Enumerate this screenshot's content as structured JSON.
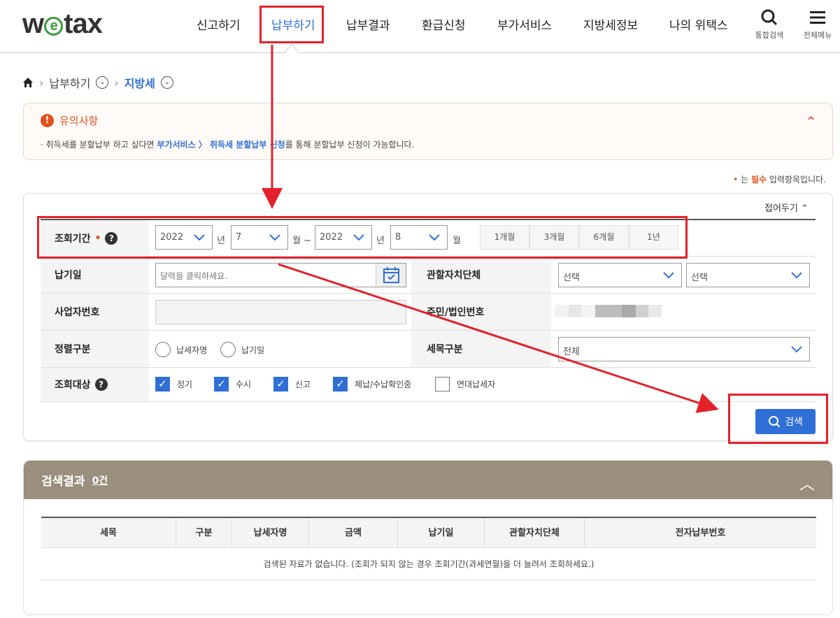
{
  "header": {
    "logo_prefix": "w",
    "logo_mid": "e",
    "logo_suffix": "tax",
    "nav": [
      "신고하기",
      "납부하기",
      "납부결과",
      "환급신청",
      "부가서비스",
      "지방세정보",
      "나의 위택스"
    ],
    "search_label": "통합검색",
    "menu_label": "전체메뉴"
  },
  "breadcrumb": {
    "level1": "납부하기",
    "level2": "지방세"
  },
  "notice": {
    "title": "유의사항",
    "text_pre": "· 취득세를 분할납부 하고 싶다면 ",
    "text_link": "부가서비스 〉 취득세 분할납부 신청",
    "text_post": "를 통해 분할납부 신청이 가능합니다."
  },
  "required_note": {
    "dot": "•",
    "pre": " 는 ",
    "word": "필수",
    "post": " 입력항목입니다."
  },
  "search_form": {
    "fold_label": "접어두기",
    "period_label": "조회기간",
    "required_mark": "•",
    "year_from": "2022",
    "month_from": "7",
    "year_to": "2022",
    "month_to": "8",
    "unit_year": "년",
    "unit_month_range": "월 ~",
    "unit_month": "월",
    "periods": [
      "1개월",
      "3개월",
      "6개월",
      "1년"
    ],
    "due_label": "납기일",
    "due_placeholder": "달력을 클릭하세요.",
    "region_label": "관할자치단체",
    "region1": "선택",
    "region2": "선택",
    "bizno_label": "사업자번호",
    "resno_label": "주민/법인번호",
    "sort_label": "정렬구분",
    "sort_options": [
      "납세자명",
      "납기일"
    ],
    "tax_label": "세목구분",
    "tax_value": "전체",
    "target_label": "조회대상",
    "targets": [
      {
        "label": "정기",
        "checked": true
      },
      {
        "label": "수시",
        "checked": true
      },
      {
        "label": "신고",
        "checked": true
      },
      {
        "label": "체납/수납확인중",
        "checked": true
      },
      {
        "label": "연대납세자",
        "checked": false
      }
    ],
    "search_button": "검색"
  },
  "results": {
    "title": "검색결과",
    "count": "0건",
    "columns": [
      "세목",
      "구분",
      "납세자명",
      "금액",
      "납기일",
      "관할자치단체",
      "전자납부번호"
    ],
    "empty_message": "검색된 자료가 없습니다. (조회가 되지 않는 경우 조회기간(과세연월)을 더 늘려서 조회하세요.)"
  },
  "colors": {
    "accent": "#2f6fd6",
    "warning": "#e2501c",
    "annotation_red": "#e3212b",
    "results_header": "#9a8e7c"
  },
  "icons": [
    "home-icon",
    "chevron-right-icon",
    "chevron-circle-down-icon",
    "search-icon",
    "hamburger-menu-icon",
    "exclamation-icon",
    "chevron-up-icon",
    "help-icon",
    "calendar-icon",
    "chevron-down-icon",
    "check-icon"
  ]
}
